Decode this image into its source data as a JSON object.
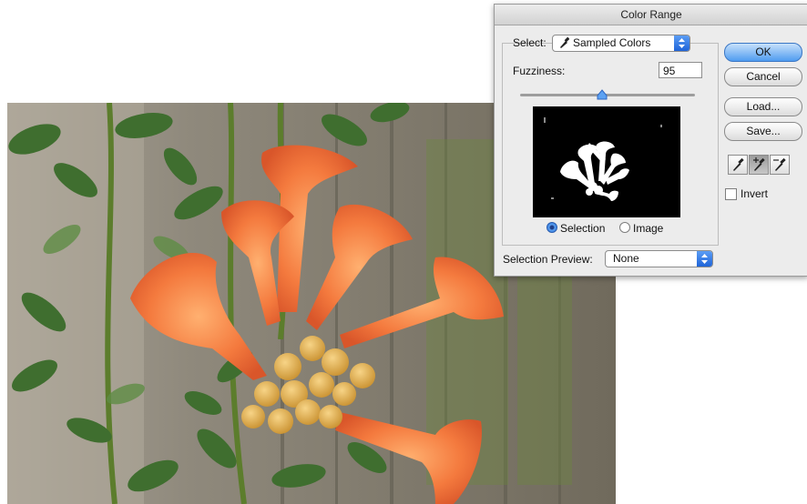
{
  "dialog": {
    "title": "Color Range",
    "select_label": "Select:",
    "select_value": "Sampled Colors",
    "fuzziness_label": "Fuzziness:",
    "fuzziness_value": "95",
    "fuzziness_slider_fraction": 0.47,
    "radio_selection": "Selection",
    "radio_image": "Image",
    "radio_selected": "Selection",
    "preview_label": "Selection Preview:",
    "preview_value": "None",
    "invert_label": "Invert",
    "invert_checked": false,
    "buttons": {
      "ok": "OK",
      "cancel": "Cancel",
      "load": "Load...",
      "save": "Save..."
    },
    "tools": [
      "eyedropper-icon",
      "eyedropper-plus-icon",
      "eyedropper-minus-icon"
    ],
    "active_tool": "eyedropper-plus-icon"
  },
  "colors": {
    "accent": "#4f9cf0",
    "flower": "#f2773e",
    "leaf": "#3f6e2f"
  }
}
